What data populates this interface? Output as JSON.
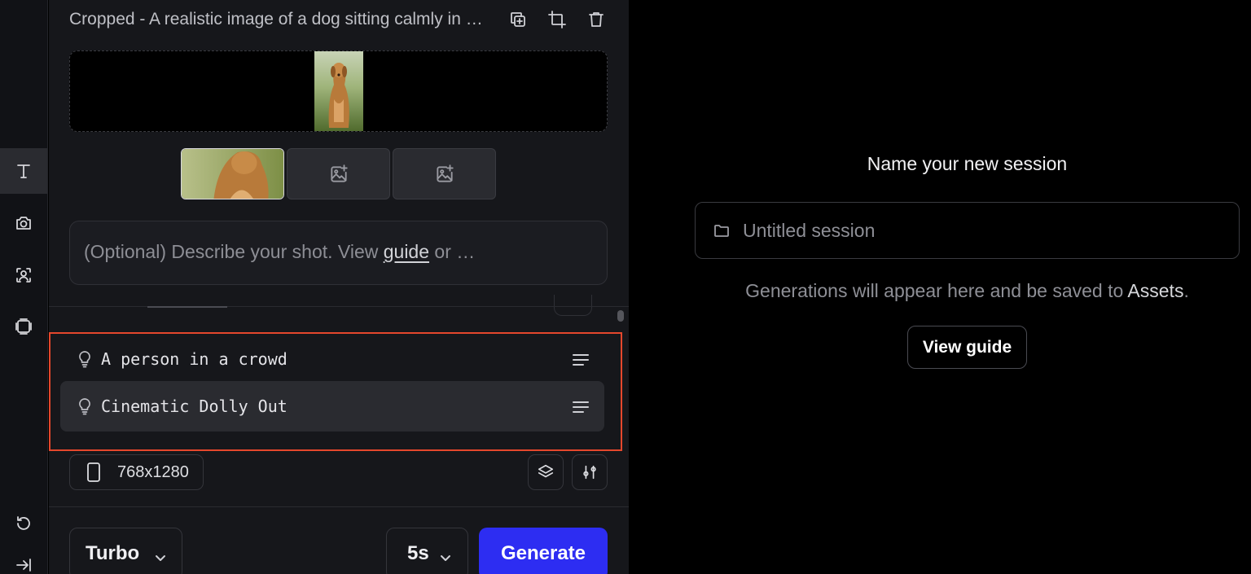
{
  "sidebar": {
    "items": [
      {
        "icon": "text-icon",
        "active": true
      },
      {
        "icon": "camera-icon",
        "active": false
      },
      {
        "icon": "face-scan-icon",
        "active": false
      },
      {
        "icon": "frames-icon",
        "active": false
      }
    ],
    "bottom": [
      {
        "icon": "undo-icon"
      },
      {
        "icon": "collapse-icon"
      }
    ]
  },
  "panel": {
    "title": "Cropped - A realistic image of a dog sitting calmly in a grassy field",
    "prompt": {
      "placeholder_prefix": "(Optional) Describe your shot. View ",
      "guide_link": "guide",
      "placeholder_suffix": " or …"
    },
    "suggestions": [
      {
        "label": "A person in a crowd",
        "highlighted": false
      },
      {
        "label": "Cinematic Dolly Out",
        "highlighted": true
      }
    ],
    "aspect_ratio": "768x1280",
    "model": "Turbo",
    "duration": "5s",
    "generate_label": "Generate"
  },
  "session": {
    "title": "Name your new session",
    "input_placeholder": "Untitled session",
    "note_prefix": "Generations will appear here and be saved to ",
    "note_link": "Assets",
    "note_suffix": ".",
    "view_guide_label": "View guide"
  },
  "colors": {
    "accent": "#2d2df2",
    "highlight_border": "#e5472c"
  }
}
